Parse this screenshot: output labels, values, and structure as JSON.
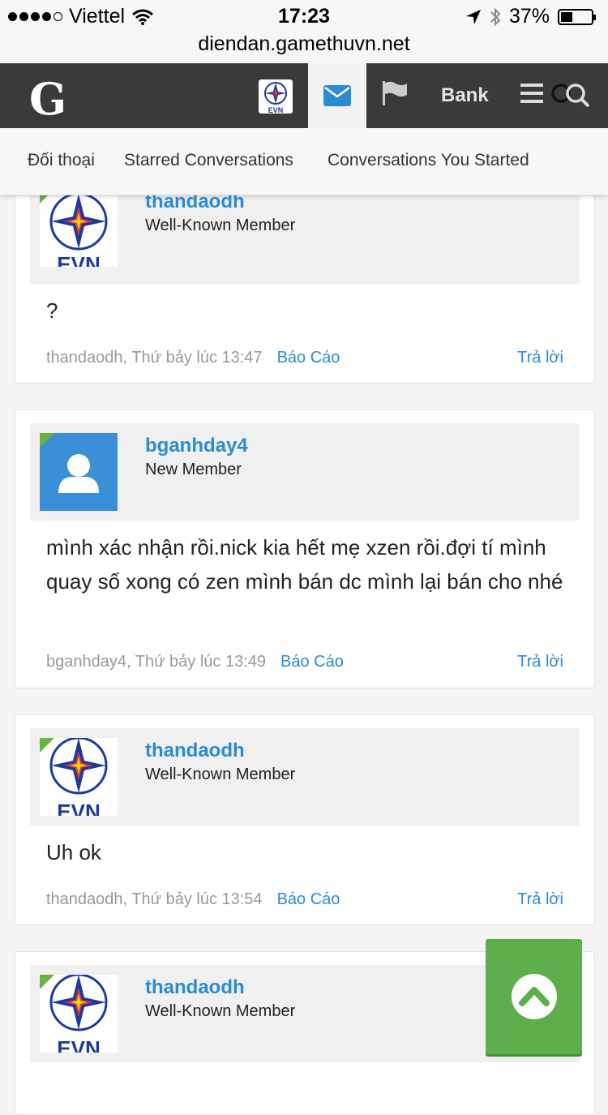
{
  "status": {
    "carrier": "Viettel",
    "time": "17:23",
    "battery": "37%",
    "url": "diendan.gamethuvn.net"
  },
  "nav": {
    "logo": "G",
    "bank_label": "Bank",
    "avatar_text": "EVN"
  },
  "subnav": [
    "Đối thoại",
    "Starred Conversations",
    "Conversations You Started"
  ],
  "evn_label": "EVN",
  "posts": [
    {
      "username": "thandaodh",
      "user_title": "Well-Known Member",
      "message": "?",
      "author_time": "thandaodh, Thứ bảy lúc 13:47",
      "report": "Báo Cáo",
      "reply": "Trả lời"
    },
    {
      "username": "bganhday4",
      "user_title": "New Member",
      "message": "mình xác nhận rồi.nick kia hết mẹ xzen rồi.đợi tí mình quay số xong có zen mình bán dc mình lại bán cho nhé",
      "author_time": "bganhday4, Thứ bảy lúc 13:49",
      "report": "Báo Cáo",
      "reply": "Trả lời"
    },
    {
      "username": "thandaodh",
      "user_title": "Well-Known Member",
      "message": "Uh ok",
      "author_time": "thandaodh, Thứ bảy lúc 13:54",
      "report": "Báo Cáo",
      "reply": "Trả lời"
    },
    {
      "username": "thandaodh",
      "user_title": "Well-Known Member"
    }
  ],
  "colors": {
    "accent": "#2b8bd4",
    "navbar": "#3a3a3a",
    "online": "#6ab23e",
    "scroll_top": "#5fae4c"
  }
}
